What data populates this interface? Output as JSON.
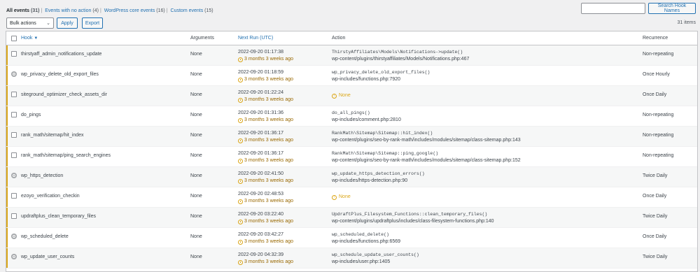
{
  "filters": [
    {
      "label": "All events",
      "count": "(31)",
      "current": true
    },
    {
      "label": "Events with no action",
      "count": "(4)",
      "current": false
    },
    {
      "label": "WordPress core events",
      "count": "(16)",
      "current": false
    },
    {
      "label": "Custom events",
      "count": "(15)",
      "current": false
    }
  ],
  "search": {
    "button_label": "Search Hook Names",
    "value": ""
  },
  "toolbar": {
    "bulk_actions": "Bulk actions",
    "apply_label": "Apply",
    "export_label": "Export",
    "items_count": "31 items"
  },
  "columns": {
    "hook": "Hook",
    "arguments": "Arguments",
    "next_run": "Next Run (UTC)",
    "action": "Action",
    "recurrence": "Recurrence"
  },
  "colors": {
    "link": "#2271b1",
    "warning": "#dba617",
    "warning_text": "#996800"
  },
  "rows": [
    {
      "control": "checkbox",
      "hook": "thirstyaff_admin_notifications_update",
      "arguments": "None",
      "next_run": "2022-09-20 01:17:38",
      "ago": "3 months 3 weeks ago",
      "action_code": "ThirstyAffiliates\\Models\\Notifications->update()",
      "action_file": "wp-content/plugins/thirstyaffiliates/Models/Notifications.php:467",
      "action_none": "",
      "recurrence": "Non-repeating"
    },
    {
      "control": "gear",
      "hook": "wp_privacy_delete_old_export_files",
      "arguments": "None",
      "next_run": "2022-09-20 01:18:59",
      "ago": "3 months 3 weeks ago",
      "action_code": "wp_privacy_delete_old_export_files()",
      "action_file": "wp-includes/functions.php:7920",
      "action_none": "",
      "recurrence": "Once Hourly"
    },
    {
      "control": "checkbox",
      "hook": "siteground_optimizer_check_assets_dir",
      "arguments": "None",
      "next_run": "2022-09-20 01:22:24",
      "ago": "3 months 3 weeks ago",
      "action_code": "",
      "action_file": "",
      "action_none": "None",
      "recurrence": "Once Daily"
    },
    {
      "control": "checkbox",
      "hook": "do_pings",
      "arguments": "None",
      "next_run": "2022-09-20 01:31:36",
      "ago": "3 months 3 weeks ago",
      "action_code": "do_all_pings()",
      "action_file": "wp-includes/comment.php:2810",
      "action_none": "",
      "recurrence": "Non-repeating"
    },
    {
      "control": "checkbox",
      "hook": "rank_math/sitemap/hit_index",
      "arguments": "None",
      "next_run": "2022-09-20 01:36:17",
      "ago": "3 months 3 weeks ago",
      "action_code": "RankMath\\Sitemap\\Sitemap::hit_index()",
      "action_file": "wp-content/plugins/seo-by-rank-math/includes/modules/sitemap/class-sitemap.php:143",
      "action_none": "",
      "recurrence": "Non-repeating"
    },
    {
      "control": "checkbox",
      "hook": "rank_math/sitemap/ping_search_engines",
      "arguments": "None",
      "next_run": "2022-09-20 01:36:17",
      "ago": "3 months 3 weeks ago",
      "action_code": "RankMath\\Sitemap\\Sitemap::ping_google()",
      "action_file": "wp-content/plugins/seo-by-rank-math/includes/modules/sitemap/class-sitemap.php:152",
      "action_none": "",
      "recurrence": "Non-repeating"
    },
    {
      "control": "gear",
      "hook": "wp_https_detection",
      "arguments": "None",
      "next_run": "2022-09-20 02:41:50",
      "ago": "3 months 3 weeks ago",
      "action_code": "wp_update_https_detection_errors()",
      "action_file": "wp-includes/https-detection.php:90",
      "action_none": "",
      "recurrence": "Twice Daily"
    },
    {
      "control": "checkbox",
      "hook": "ezoyo_verification_checkin",
      "arguments": "None",
      "next_run": "2022-09-20 02:48:53",
      "ago": "3 months 3 weeks ago",
      "action_code": "",
      "action_file": "",
      "action_none": "None",
      "recurrence": "Once Daily"
    },
    {
      "control": "checkbox",
      "hook": "updraftplus_clean_temporary_files",
      "arguments": "None",
      "next_run": "2022-09-20 03:22:40",
      "ago": "3 months 3 weeks ago",
      "action_code": "UpdraftPlus_Filesystem_Functions::clean_temporary_files()",
      "action_file": "wp-content/plugins/updraftplus/includes/class-filesystem-functions.php:140",
      "action_none": "",
      "recurrence": "Twice Daily"
    },
    {
      "control": "gear",
      "hook": "wp_scheduled_delete",
      "arguments": "None",
      "next_run": "2022-09-20 03:42:27",
      "ago": "3 months 3 weeks ago",
      "action_code": "wp_scheduled_delete()",
      "action_file": "wp-includes/functions.php:6569",
      "action_none": "",
      "recurrence": "Once Daily"
    },
    {
      "control": "gear",
      "hook": "wp_update_user_counts",
      "arguments": "None",
      "next_run": "2022-09-20 04:32:39",
      "ago": "3 months 3 weeks ago",
      "action_code": "wp_schedule_update_user_counts()",
      "action_file": "wp-includes/user.php:1405",
      "action_none": "",
      "recurrence": "Twice Daily"
    }
  ]
}
